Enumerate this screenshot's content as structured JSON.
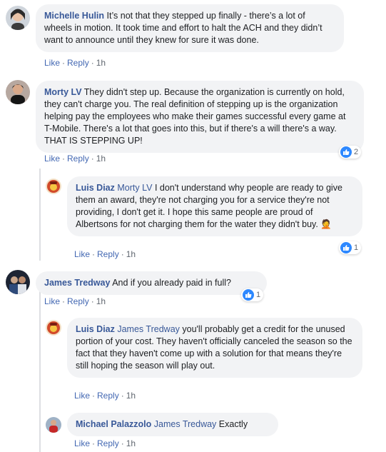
{
  "comments": [
    {
      "author": "Michelle Hulin",
      "text": "It’s not that they stepped up finally - there’s a lot of wheels in motion. It took time and effort to halt the ACH and they didn’t want to announce until they knew for sure it was done.",
      "like": "Like",
      "reply": "Reply",
      "time": "1h"
    },
    {
      "author": "Morty LV",
      "text": "They didn't step up. Because the organization is currently on hold, they can't charge you. The real definition of stepping up is the organization helping pay the employees who make their games successful every game at T-Mobile. There's a lot that goes into this, but if there's a will there's a way. THAT IS STEPPING UP!",
      "like": "Like",
      "reply": "Reply",
      "time": "1h",
      "reactions": "2"
    },
    {
      "author": "Luis Diaz",
      "mention": "Morty LV",
      "text": "I don't understand why people are ready to give them an award, they're not charging you for a service they're not providing, I don't get it. I hope this same people are proud of Albertsons for not charging them for the water they didn't buy.",
      "emoji": "🤦",
      "like": "Like",
      "reply": "Reply",
      "time": "1h",
      "reactions": "1"
    },
    {
      "author": "James Tredway",
      "text": "And if you already paid in full?",
      "like": "Like",
      "reply": "Reply",
      "time": "1h",
      "reactions": "1"
    },
    {
      "author": "Luis Diaz",
      "mention": "James Tredway",
      "text": "you'll probably get a credit for the unused portion of your cost. They haven't officially canceled the season so the fact that they haven't come up with a solution for that means they're still hoping the season will play out.",
      "like": "Like",
      "reply": "Reply",
      "time": "1h"
    },
    {
      "author": "Michael Palazzolo",
      "mention": "James Tredway",
      "text": "Exactly",
      "like": "Like",
      "reply": "Reply",
      "time": "1h"
    }
  ],
  "separator": "·",
  "colors": {
    "link": "#385898",
    "bubble": "#f2f3f5",
    "like_blue": "#2d88ff"
  }
}
